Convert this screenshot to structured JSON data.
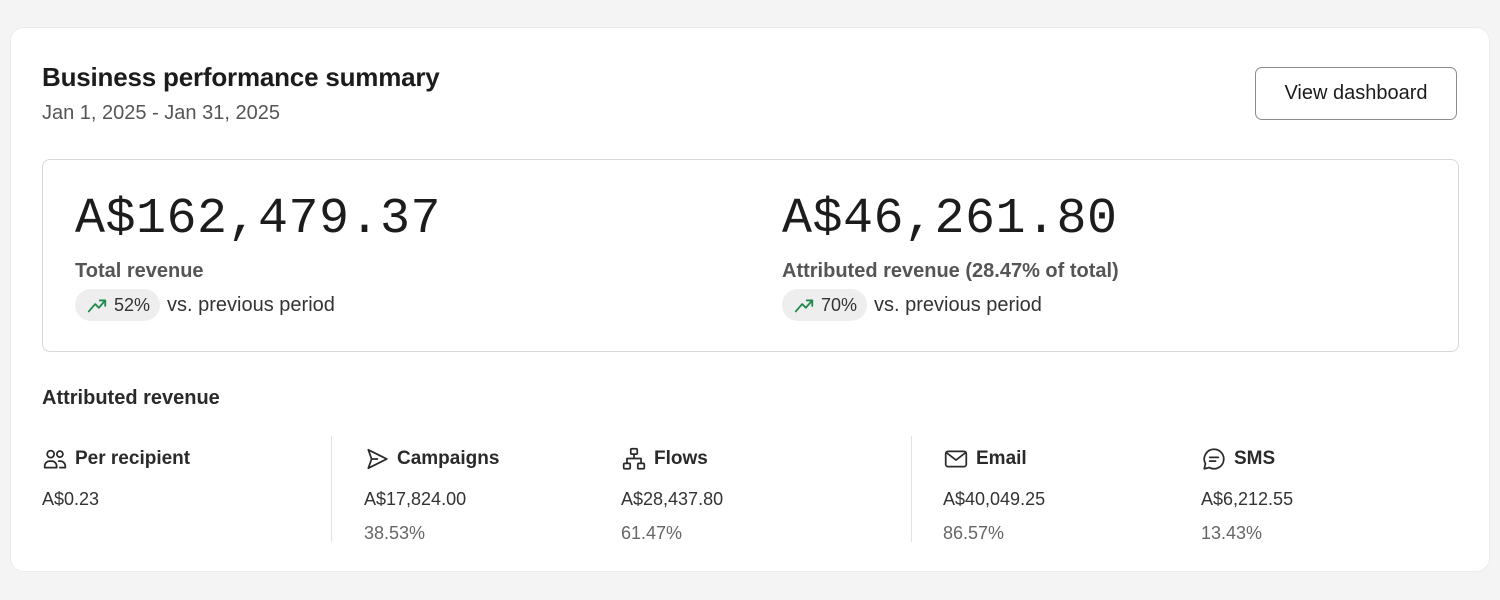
{
  "header": {
    "title": "Business performance summary",
    "date_range": "Jan 1, 2025 - Jan 31, 2025",
    "view_button": "View dashboard"
  },
  "summary": {
    "total": {
      "value": "A$162,479.37",
      "label": "Total revenue",
      "change": "52%",
      "change_suffix": "vs. previous period"
    },
    "attributed": {
      "value": "A$46,261.80",
      "label": "Attributed revenue (28.47% of total)",
      "change": "70%",
      "change_suffix": "vs. previous period"
    }
  },
  "attributed_section": {
    "title": "Attributed revenue",
    "stats": {
      "per_recipient": {
        "label": "Per recipient",
        "icon": "users-icon",
        "value": "A$0.23"
      },
      "campaigns": {
        "label": "Campaigns",
        "icon": "send-icon",
        "value": "A$17,824.00",
        "percent": "38.53%"
      },
      "flows": {
        "label": "Flows",
        "icon": "flow-icon",
        "value": "A$28,437.80",
        "percent": "61.47%"
      },
      "email": {
        "label": "Email",
        "icon": "mail-icon",
        "value": "A$40,049.25",
        "percent": "86.57%"
      },
      "sms": {
        "label": "SMS",
        "icon": "chat-icon",
        "value": "A$6,212.55",
        "percent": "13.43%"
      }
    }
  },
  "colors": {
    "trend_up": "#1f8a4c",
    "text": "#1c1c1c",
    "muted": "#555555"
  }
}
